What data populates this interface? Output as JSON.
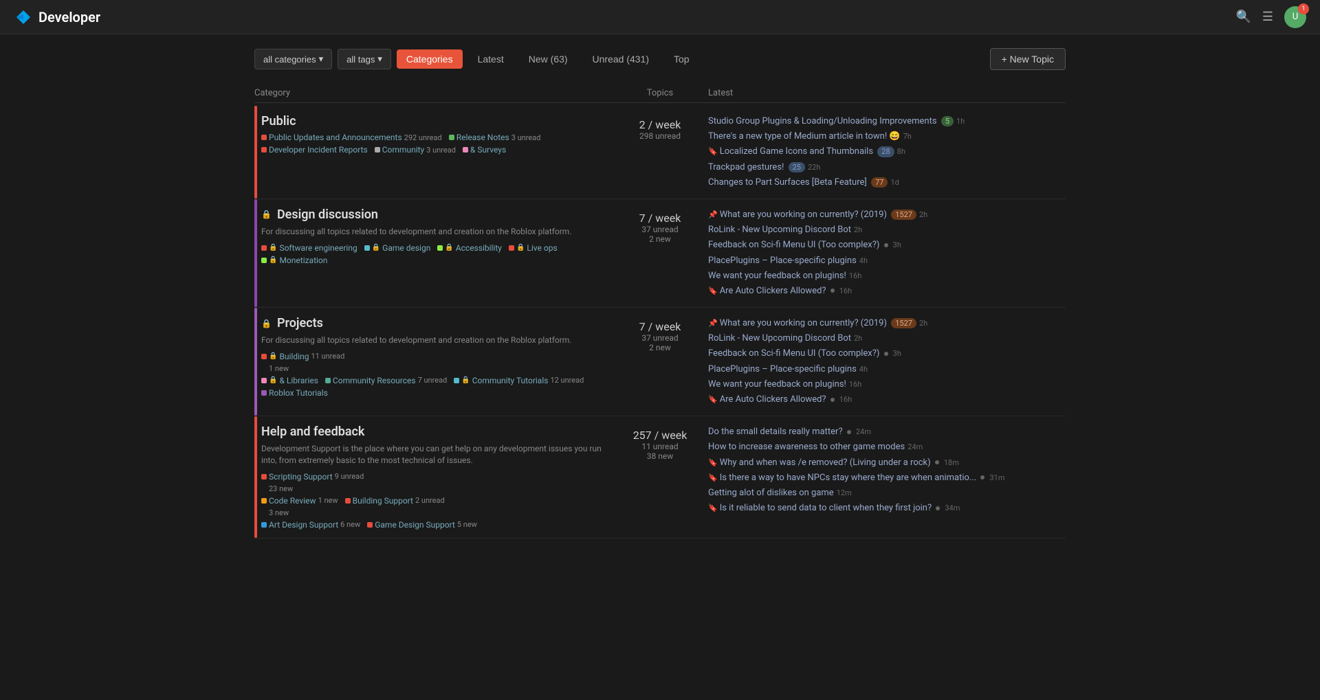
{
  "header": {
    "logo_text": "Developer",
    "notification_count": "1"
  },
  "filters": {
    "categories_label": "all categories",
    "tags_label": "all tags",
    "chevron": "▾"
  },
  "tabs": [
    {
      "id": "categories",
      "label": "Categories",
      "active": true
    },
    {
      "id": "latest",
      "label": "Latest",
      "active": false
    },
    {
      "id": "new",
      "label": "New (63)",
      "active": false
    },
    {
      "id": "unread",
      "label": "Unread (431)",
      "active": false
    },
    {
      "id": "top",
      "label": "Top",
      "active": false
    }
  ],
  "new_topic_btn": "+ New Topic",
  "table_headers": {
    "category": "Category",
    "topics": "Topics",
    "latest": "Latest"
  },
  "categories": [
    {
      "id": "public",
      "title": "Public",
      "border_color": "#e74c3c",
      "description": "",
      "stats": {
        "per_week": "2",
        "unit": "/ week",
        "unread": "298 unread"
      },
      "subcats": [
        {
          "color": "#e74c3c",
          "lock": false,
          "name": "Public Updates and Announcements",
          "count": "292 unread"
        },
        {
          "color": "#5cb85c",
          "lock": false,
          "name": "Release Notes",
          "count": "3 unread"
        },
        {
          "color": "#e74c3c",
          "lock": false,
          "name": "Developer Incident Reports",
          "count": ""
        },
        {
          "color": "#aaa",
          "lock": false,
          "name": "Community",
          "count": "3 unread"
        },
        {
          "color": "#e8b",
          "lock": false,
          "name": "& Surveys",
          "count": ""
        }
      ],
      "topics": [
        {
          "pin": false,
          "bookmark": false,
          "text": "Studio Group Plugins & Loading/Unloading Improvements",
          "badge": "5",
          "badge_color": "green",
          "time": "1h"
        },
        {
          "pin": false,
          "bookmark": false,
          "text": "There's a new type of Medium article in town! 😄",
          "badge": "",
          "time": "7h"
        },
        {
          "pin": false,
          "bookmark": true,
          "text": "Localized Game Icons and Thumbnails",
          "badge": "28",
          "badge_color": "blue",
          "time": "8h"
        },
        {
          "pin": false,
          "bookmark": false,
          "text": "Trackpad gestures!",
          "badge": "25",
          "badge_color": "blue",
          "time": "22h"
        },
        {
          "pin": false,
          "bookmark": false,
          "text": "Changes to Part Surfaces [Beta Feature]",
          "badge": "77",
          "badge_color": "orange",
          "time": "1d"
        }
      ]
    },
    {
      "id": "design-discussion",
      "title": "Design discussion",
      "border_color": "#8e44ad",
      "lock": true,
      "description": "For discussing all topics related to development and creation on the Roblox platform.",
      "stats": {
        "per_week": "7",
        "unit": "/ week",
        "unread": "37 unread",
        "new": "2 new"
      },
      "subcats": [
        {
          "color": "#e74c3c",
          "lock": true,
          "name": "Software engineering",
          "count": ""
        },
        {
          "color": "#5bc",
          "lock": true,
          "name": "Game design",
          "count": ""
        },
        {
          "color": "#8e4",
          "lock": true,
          "name": "Accessibility",
          "count": ""
        },
        {
          "color": "#e74c3c",
          "lock": true,
          "name": "Live ops",
          "count": ""
        },
        {
          "color": "#8e4",
          "lock": true,
          "name": "Monetization",
          "count": ""
        }
      ],
      "topics": [
        {
          "pin": true,
          "bookmark": false,
          "text": "What are you working on currently? (2019)",
          "badge": "1527",
          "badge_color": "orange",
          "time": "2h"
        },
        {
          "pin": false,
          "bookmark": false,
          "text": "RoLink - New Upcoming Discord Bot",
          "badge": "",
          "time": "2h"
        },
        {
          "pin": false,
          "bookmark": false,
          "text": "Feedback on Sci-fi Menu UI (Too complex?)",
          "dot": true,
          "time": "3h"
        },
        {
          "pin": false,
          "bookmark": false,
          "text": "PlacePlugins – Place-specific plugins",
          "time": "4h"
        },
        {
          "pin": false,
          "bookmark": false,
          "text": "We want your feedback on plugins!",
          "time": "16h"
        },
        {
          "pin": false,
          "bookmark": true,
          "text": "Are Auto Clickers Allowed?",
          "dot": true,
          "time": "16h"
        }
      ]
    },
    {
      "id": "projects",
      "title": "Projects",
      "border_color": "#9b59b6",
      "lock": true,
      "description": "For discussing all topics related to development and creation on the Roblox platform.",
      "stats": {
        "per_week": "7",
        "unit": "/ week",
        "unread": "37 unread",
        "new": "2 new"
      },
      "subcats": [
        {
          "color": "#e74c3c",
          "lock": true,
          "name": "Building",
          "count": "11 unread",
          "extra": "1 new"
        },
        {
          "color": "#e8b",
          "lock": true,
          "name": "& Libraries",
          "count": ""
        },
        {
          "color": "#5a9",
          "lock": false,
          "name": "Community Resources",
          "count": "7 unread"
        },
        {
          "color": "#5bc",
          "lock": true,
          "name": "Community Tutorials",
          "count": "12 unread"
        },
        {
          "color": "#9b59b6",
          "lock": false,
          "name": "Roblox Tutorials",
          "count": ""
        }
      ],
      "topics": [
        {
          "pin": true,
          "bookmark": false,
          "text": "What are you working on currently? (2019)",
          "badge": "1527",
          "badge_color": "orange",
          "time": "2h"
        },
        {
          "pin": false,
          "bookmark": false,
          "text": "RoLink - New Upcoming Discord Bot",
          "badge": "",
          "time": "2h"
        },
        {
          "pin": false,
          "bookmark": false,
          "text": "Feedback on Sci-fi Menu UI (Too complex?)",
          "dot": true,
          "time": "3h"
        },
        {
          "pin": false,
          "bookmark": false,
          "text": "PlacePlugins – Place-specific plugins",
          "time": "4h"
        },
        {
          "pin": false,
          "bookmark": false,
          "text": "We want your feedback on plugins!",
          "time": "16h"
        },
        {
          "pin": false,
          "bookmark": true,
          "text": "Are Auto Clickers Allowed?",
          "dot": true,
          "time": "16h"
        }
      ]
    },
    {
      "id": "help-and-feedback",
      "title": "Help and feedback",
      "border_color": "#e74c3c",
      "description": "Development Support is the place where you can get help on any development issues you run into, from extremely basic to the most technical of issues.",
      "stats": {
        "per_week": "257",
        "unit": "/ week",
        "unread": "11 unread",
        "new": "38 new"
      },
      "subcats": [
        {
          "color": "#e74c3c",
          "lock": false,
          "name": "Scripting Support",
          "count": "9 unread",
          "extra": "23 new"
        },
        {
          "color": "#f39c12",
          "lock": false,
          "name": "Code Review",
          "count": "1 new"
        },
        {
          "color": "#e74c3c",
          "lock": false,
          "name": "Building Support",
          "count": "2 unread",
          "extra": "3 new"
        },
        {
          "color": "#3498db",
          "lock": false,
          "name": "Art Design Support",
          "count": "6 new"
        },
        {
          "color": "#e74c3c",
          "lock": false,
          "name": "Game Design Support",
          "count": "5 new"
        }
      ],
      "topics": [
        {
          "pin": false,
          "bookmark": false,
          "text": "Do the small details really matter?",
          "dot": true,
          "time": "24m"
        },
        {
          "pin": false,
          "bookmark": false,
          "text": "How to increase awareness to other game modes",
          "time": "24m"
        },
        {
          "pin": false,
          "bookmark": true,
          "text": "Why and when was /e removed? (Living under a rock)",
          "dot": true,
          "time": "18m"
        },
        {
          "pin": false,
          "bookmark": true,
          "text": "Is there a way to have NPCs stay where they are when animatio...",
          "dot": true,
          "time": "31m"
        },
        {
          "pin": false,
          "bookmark": false,
          "text": "Getting alot of dislikes on game",
          "time": "12m"
        },
        {
          "pin": false,
          "bookmark": true,
          "text": "Is it reliable to send data to client when they first join?",
          "dot": true,
          "time": "34m"
        }
      ]
    }
  ]
}
